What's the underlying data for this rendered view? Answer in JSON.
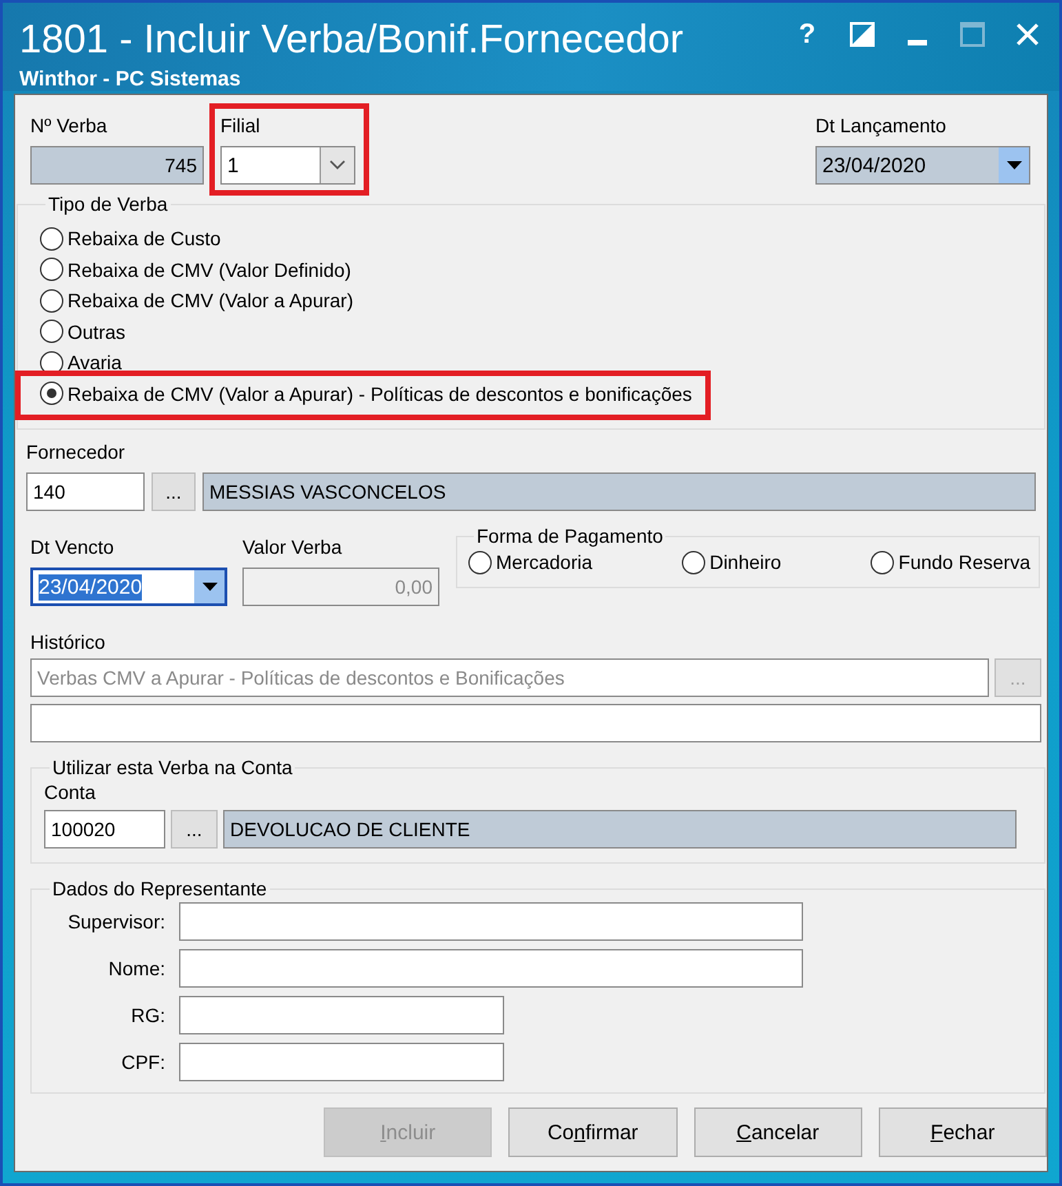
{
  "window": {
    "title": "1801 - Incluir Verba/Bonif.Fornecedor",
    "subtitle": "Winthor - PC Sistemas",
    "controls": [
      {
        "kind": "help",
        "text": "?",
        "disabled": false
      },
      {
        "kind": "contrast",
        "disabled": false
      },
      {
        "kind": "minimize",
        "disabled": false
      },
      {
        "kind": "maximize",
        "disabled": true
      },
      {
        "kind": "close",
        "disabled": false
      }
    ]
  },
  "numero_verba": {
    "label": "Nº Verba",
    "value": "745"
  },
  "filial": {
    "label": "Filial",
    "value": "1",
    "highlighted": true
  },
  "dt_lancamento": {
    "label": "Dt Lançamento",
    "value": "23/04/2020"
  },
  "tipo_verba": {
    "title": "Tipo de Verba",
    "options": [
      {
        "label": "Rebaixa de Custo",
        "selected": false,
        "highlighted": false
      },
      {
        "label": "Rebaixa de CMV (Valor Definido)",
        "selected": false,
        "highlighted": false
      },
      {
        "label": "Rebaixa de CMV (Valor a Apurar)",
        "selected": false,
        "highlighted": false
      },
      {
        "label": "Outras",
        "selected": false,
        "highlighted": false
      },
      {
        "label": "Avaria",
        "selected": false,
        "highlighted": false
      },
      {
        "label": "Rebaixa de CMV (Valor a Apurar) - Políticas de descontos e bonificações",
        "selected": true,
        "highlighted": true
      }
    ]
  },
  "fornecedor": {
    "label": "Fornecedor",
    "code": "140",
    "browse": "...",
    "name": "MESSIAS VASCONCELOS"
  },
  "dt_vencto": {
    "label": "Dt Vencto",
    "value": "23/04/2020",
    "focused": true
  },
  "valor_verba": {
    "label": "Valor Verba",
    "value": "0,00",
    "disabled": true
  },
  "forma_pagamento": {
    "title": "Forma de Pagamento",
    "options": [
      {
        "label": "Mercadoria",
        "selected": false
      },
      {
        "label": "Dinheiro",
        "selected": false
      },
      {
        "label": "Fundo Reserva",
        "selected": false
      }
    ]
  },
  "historico": {
    "label": "Histórico",
    "value": "Verbas CMV a Apurar - Políticas de descontos e Bonificações",
    "disabled": true,
    "browse": "...",
    "browse_disabled": true
  },
  "conta_group": {
    "title": "Utilizar esta Verba na Conta",
    "label": "Conta",
    "code": "100020",
    "browse": "...",
    "name": "DEVOLUCAO DE CLIENTE"
  },
  "representante": {
    "title": "Dados do Representante",
    "fields": [
      {
        "label": "Supervisor:",
        "kind": "wide"
      },
      {
        "label": "Nome:",
        "kind": "wide"
      },
      {
        "label": "RG:",
        "kind": "narrow"
      },
      {
        "label": "CPF:",
        "kind": "narrow"
      }
    ]
  },
  "buttons": [
    {
      "access_key": "I",
      "label_after": "ncluir",
      "disabled": true
    },
    {
      "label_before": "Co",
      "access_key": "n",
      "label_after": "firmar",
      "disabled": false
    },
    {
      "access_key": "C",
      "label_after": "ancelar",
      "disabled": false
    },
    {
      "access_key": "F",
      "label_after": "echar",
      "disabled": false
    }
  ]
}
